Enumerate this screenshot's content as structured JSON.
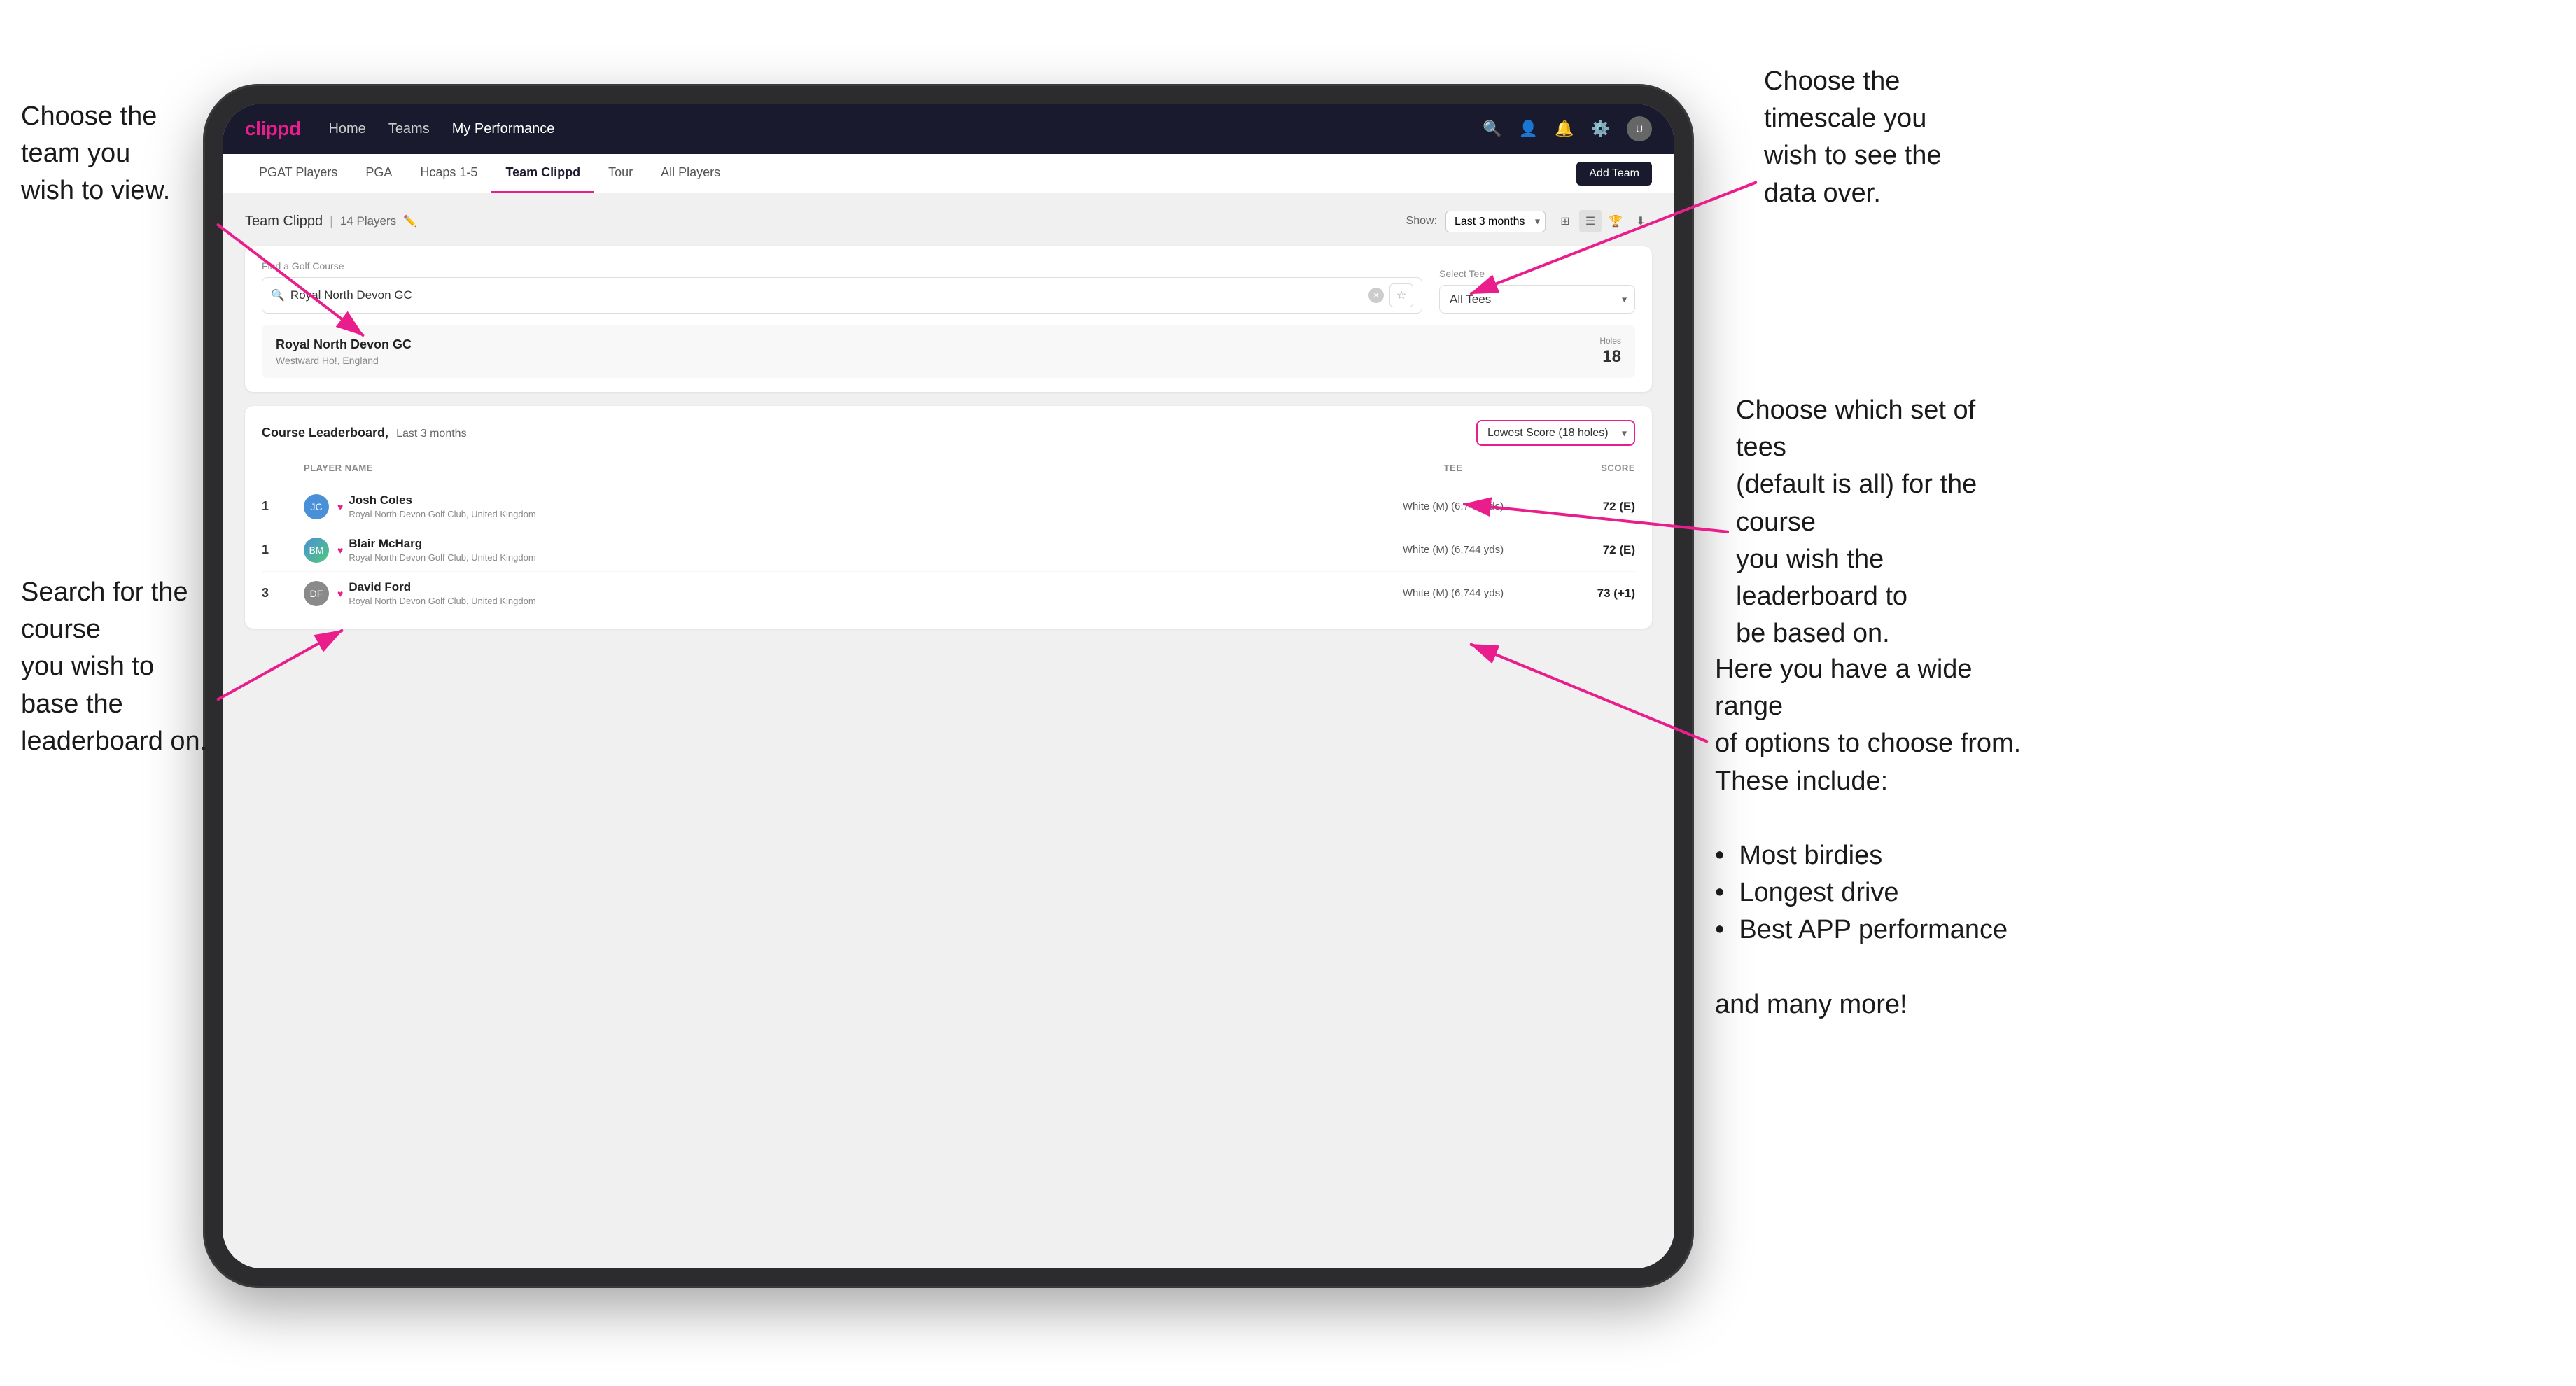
{
  "annotations": {
    "top_left": "Choose the team you\nwish to view.",
    "bottom_left": "Search for the course\nyou wish to base the\nleaderboard on.",
    "top_right": "Choose the timescale you\nwish to see the data over.",
    "middle_right": "Choose which set of tees\n(default is all) for the course\nyou wish the leaderboard to\nbe based on.",
    "bottom_right_title": "Here you have a wide range\nof options to choose from.\nThese include:",
    "bottom_right_bullets": [
      "Most birdies",
      "Longest drive",
      "Best APP performance"
    ],
    "bottom_right_footer": "and many more!"
  },
  "nav": {
    "logo": "clippd",
    "links": [
      "Home",
      "Teams",
      "My Performance"
    ],
    "active_link": "My Performance"
  },
  "sub_tabs": {
    "tabs": [
      "PGAT Players",
      "PGA",
      "Hcaps 1-5",
      "Team Clippd",
      "Tour",
      "All Players"
    ],
    "active_tab": "Team Clippd",
    "add_team_label": "Add Team"
  },
  "team_header": {
    "title": "Team Clippd",
    "player_count": "14 Players",
    "show_label": "Show:",
    "show_value": "Last 3 months"
  },
  "search": {
    "find_label": "Find a Golf Course",
    "placeholder": "Royal North Devon GC",
    "tee_label": "Select Tee",
    "tee_value": "All Tees"
  },
  "course_result": {
    "name": "Royal North Devon GC",
    "location": "Westward Ho!, England",
    "holes_label": "Holes",
    "holes_value": "18"
  },
  "leaderboard": {
    "title": "Course Leaderboard,",
    "subtitle": "Last 3 months",
    "score_option": "Lowest Score (18 holes)",
    "col_player": "PLAYER NAME",
    "col_tee": "TEE",
    "col_score": "SCORE",
    "players": [
      {
        "rank": "1",
        "name": "Josh Coles",
        "club": "Royal North Devon Golf Club, United Kingdom",
        "tee": "White (M) (6,744 yds)",
        "score": "72 (E)",
        "avatar_color": "blue"
      },
      {
        "rank": "1",
        "name": "Blair McHarg",
        "club": "Royal North Devon Golf Club, United Kingdom",
        "tee": "White (M) (6,744 yds)",
        "score": "72 (E)",
        "avatar_color": "multi"
      },
      {
        "rank": "3",
        "name": "David Ford",
        "club": "Royal North Devon Golf Club, United Kingdom",
        "tee": "White (M) (6,744 yds)",
        "score": "73 (+1)",
        "avatar_color": "gray"
      }
    ]
  }
}
